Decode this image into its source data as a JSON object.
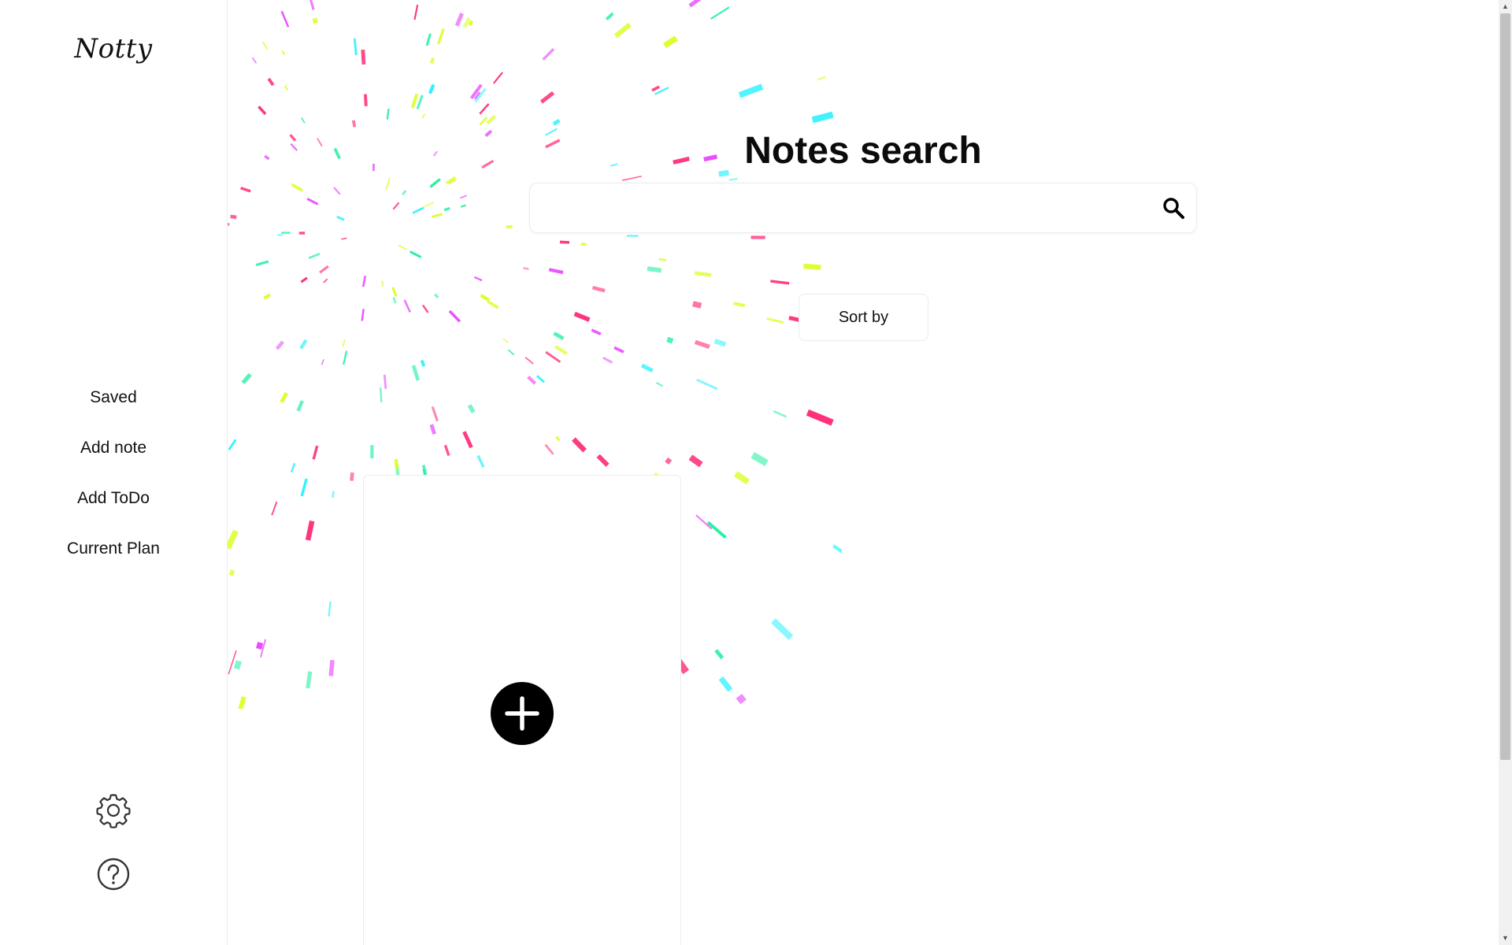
{
  "app": {
    "logo": "Notty"
  },
  "sidebar": {
    "items": [
      {
        "label": "Saved"
      },
      {
        "label": "Add note"
      },
      {
        "label": "Add ToDo"
      },
      {
        "label": "Current Plan"
      }
    ],
    "icons": [
      "gear-icon",
      "help-icon"
    ]
  },
  "main": {
    "title": "Notes search",
    "search": {
      "value": "",
      "placeholder": "",
      "icon": "search-icon"
    },
    "sort_label": "Sort by",
    "add_card": {
      "icon": "plus-icon"
    }
  },
  "colors": {
    "background": "#ffffff",
    "text": "#111111",
    "border": "#ececec",
    "accent_button": "#000000",
    "burst": [
      "#ff2d7a",
      "#e94cff",
      "#2ef2ff",
      "#d9ff1f",
      "#22f0a0"
    ]
  }
}
